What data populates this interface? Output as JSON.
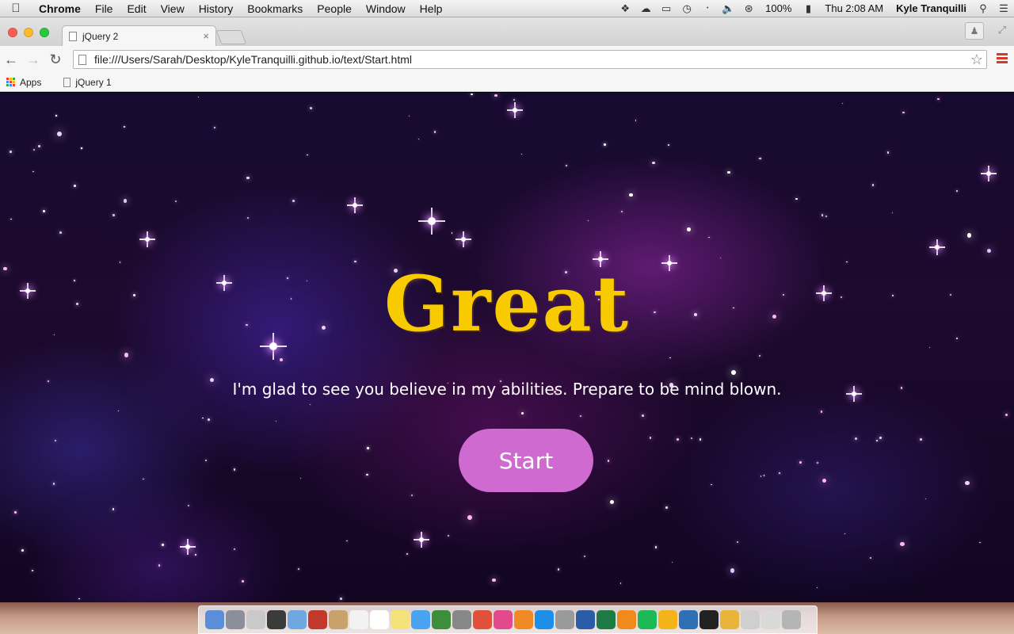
{
  "menubar": {
    "app_name": "Chrome",
    "menus": [
      "File",
      "Edit",
      "View",
      "History",
      "Bookmarks",
      "People",
      "Window",
      "Help"
    ],
    "battery": "100%",
    "clock": "Thu 2:08 AM",
    "user": "Kyle Tranquilli",
    "status_icons": [
      "dropbox-icon",
      "creative-cloud-icon",
      "airplay-icon",
      "time-machine-icon",
      "bluetooth-icon",
      "volume-icon",
      "wifi-icon",
      "battery-icon"
    ]
  },
  "tab": {
    "title": "jQuery 2",
    "close": "×"
  },
  "address_bar": {
    "url": "file:///Users/Sarah/Desktop/KyleTranquilli.github.io/text/Start.html"
  },
  "bookmarks": {
    "apps_label": "Apps",
    "items": [
      "jQuery 1"
    ]
  },
  "page": {
    "headline": "Great",
    "subtitle": "I'm glad to see you believe in my abilities. Prepare to be mind blown.",
    "start_button": "Start"
  },
  "colors": {
    "headline": "#f7cb00",
    "button": "#cf6ad1"
  },
  "dock_icons": [
    "finder-icon",
    "launchpad-icon",
    "help-icon",
    "terminal-icon",
    "preview-icon",
    "photo-booth-icon",
    "contacts-icon",
    "calendar-icon",
    "textedit-icon",
    "notes-icon",
    "messages-icon",
    "facetime-icon",
    "photos-icon",
    "acrobat-icon",
    "itunes-icon",
    "ibooks-icon",
    "app-store-icon",
    "preferences-icon",
    "word-icon",
    "excel-icon",
    "vlc-icon",
    "spotify-icon",
    "outlook-icon",
    "dashboard-icon",
    "github-icon",
    "chrome-icon",
    "downloads-icon",
    "documents-icon",
    "trash-icon"
  ]
}
